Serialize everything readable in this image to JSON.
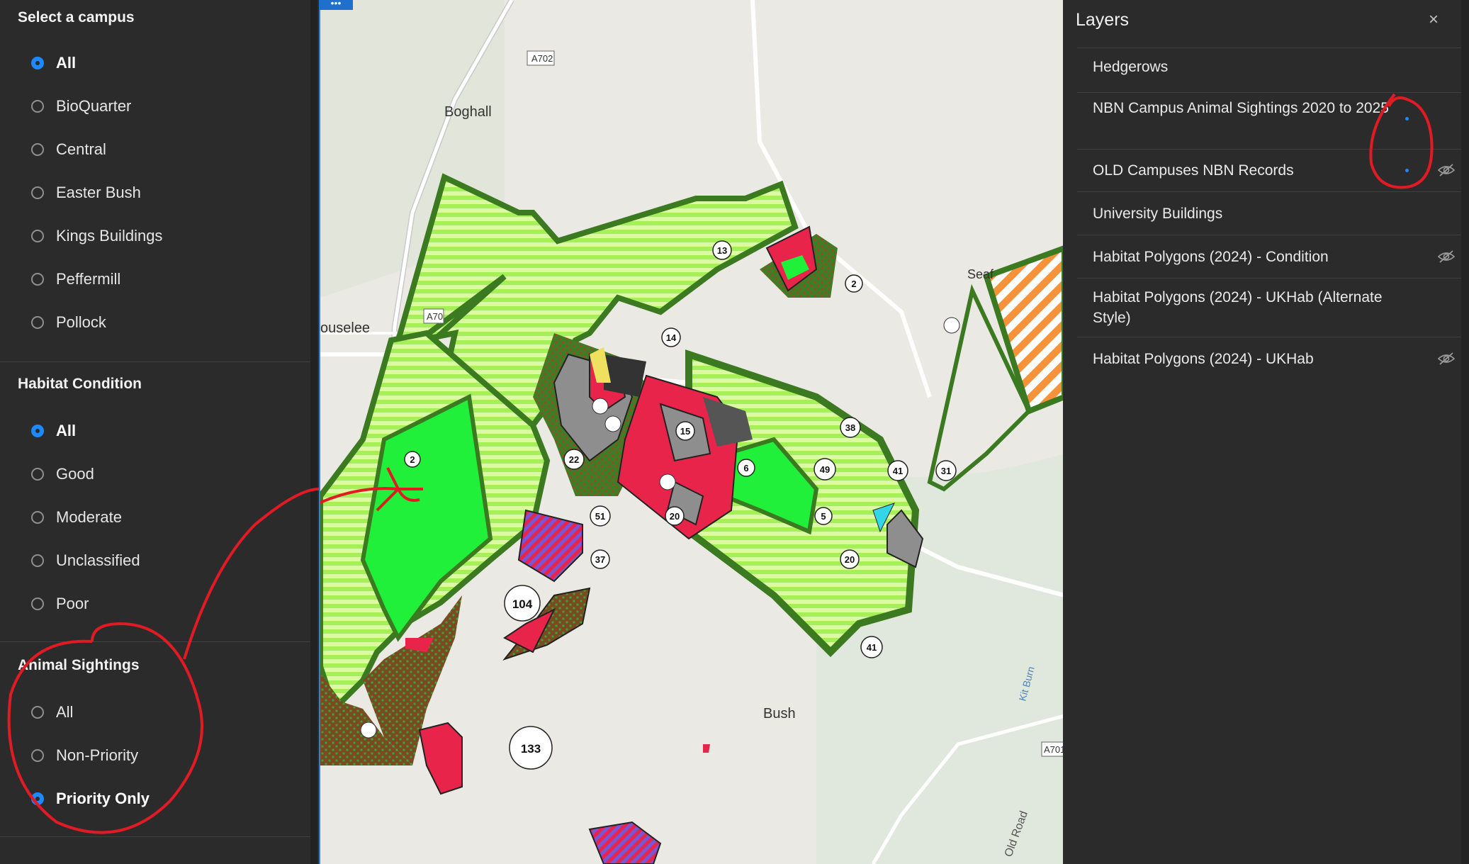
{
  "filters": {
    "campus": {
      "title": "Select a campus",
      "options": [
        "All",
        "BioQuarter",
        "Central",
        "Easter Bush",
        "Kings Buildings",
        "Peffermill",
        "Pollock"
      ],
      "selected": "All"
    },
    "habitat_condition": {
      "title": "Habitat Condition",
      "options": [
        "All",
        "Good",
        "Moderate",
        "Unclassified",
        "Poor"
      ],
      "selected": "All"
    },
    "animal_sightings": {
      "title": "Animal Sightings",
      "options": [
        "All",
        "Non-Priority",
        "Priority Only"
      ],
      "selected": "Priority Only"
    }
  },
  "map": {
    "menu_button": "•••",
    "place_labels": [
      "Boghall",
      "ouselee",
      "Bush",
      "Seaf",
      "Old Road",
      "Kit Burn"
    ],
    "road_labels": [
      "A702",
      "A70",
      "A701"
    ],
    "cluster_counts": [
      "13",
      "2",
      "14",
      "15",
      "38",
      "22",
      "2",
      "6",
      "49",
      "41",
      "31",
      "51",
      "20",
      "5",
      "37",
      "20",
      "104",
      "41",
      "133"
    ]
  },
  "layers_panel": {
    "title": "Layers",
    "close_icon": "×",
    "items": [
      {
        "label": "Hedgerows",
        "hidden": false,
        "dot": false
      },
      {
        "label": "NBN Campus Animal Sightings 2020 to 2025",
        "hidden": false,
        "dot": true
      },
      {
        "label": "OLD Campuses NBN Records",
        "hidden": true,
        "dot": true
      },
      {
        "label": "University Buildings",
        "hidden": false,
        "dot": false
      },
      {
        "label": "Habitat Polygons (2024) - Condition",
        "hidden": true,
        "dot": false
      },
      {
        "label": "Habitat Polygons (2024) - UKHab (Alternate Style)",
        "hidden": false,
        "dot": false
      },
      {
        "label": "Habitat Polygons (2024) - UKHab",
        "hidden": true,
        "dot": false
      }
    ]
  },
  "colors": {
    "accent": "#1e88ff",
    "annotation": "#e01b24",
    "habitat_light_green": "#b9f36c",
    "habitat_bright_green": "#21f03b",
    "hedgerow": "#3c7a22",
    "buildings": "#e8244a"
  }
}
